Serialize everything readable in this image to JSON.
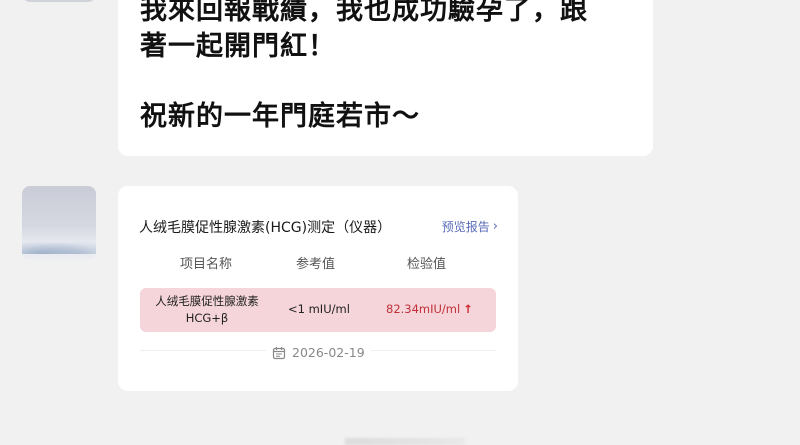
{
  "message": {
    "line1": "我來回報戰績，我也成功驗孕了，跟",
    "line2": "著一起開門紅！",
    "line3": "祝新的一年門庭若市～"
  },
  "report": {
    "title": "人绒毛膜促性腺激素(HCG)测定（仪器）",
    "preview_label": "预览报告",
    "chevron_icon": "chevron-right-icon",
    "columns": [
      "项目名称",
      "参考值",
      "检验值"
    ],
    "row": {
      "name_line1": "人绒毛膜促性腺激素",
      "name_line2": "HCG+β",
      "reference": "<1 mIU/ml",
      "value": "82.34mIU/ml",
      "flag_icon": "arrow-up-icon",
      "flag": "↑"
    },
    "date": "2026-02-19",
    "highlight_color": "#f5d5da",
    "value_color": "#c0303a"
  }
}
